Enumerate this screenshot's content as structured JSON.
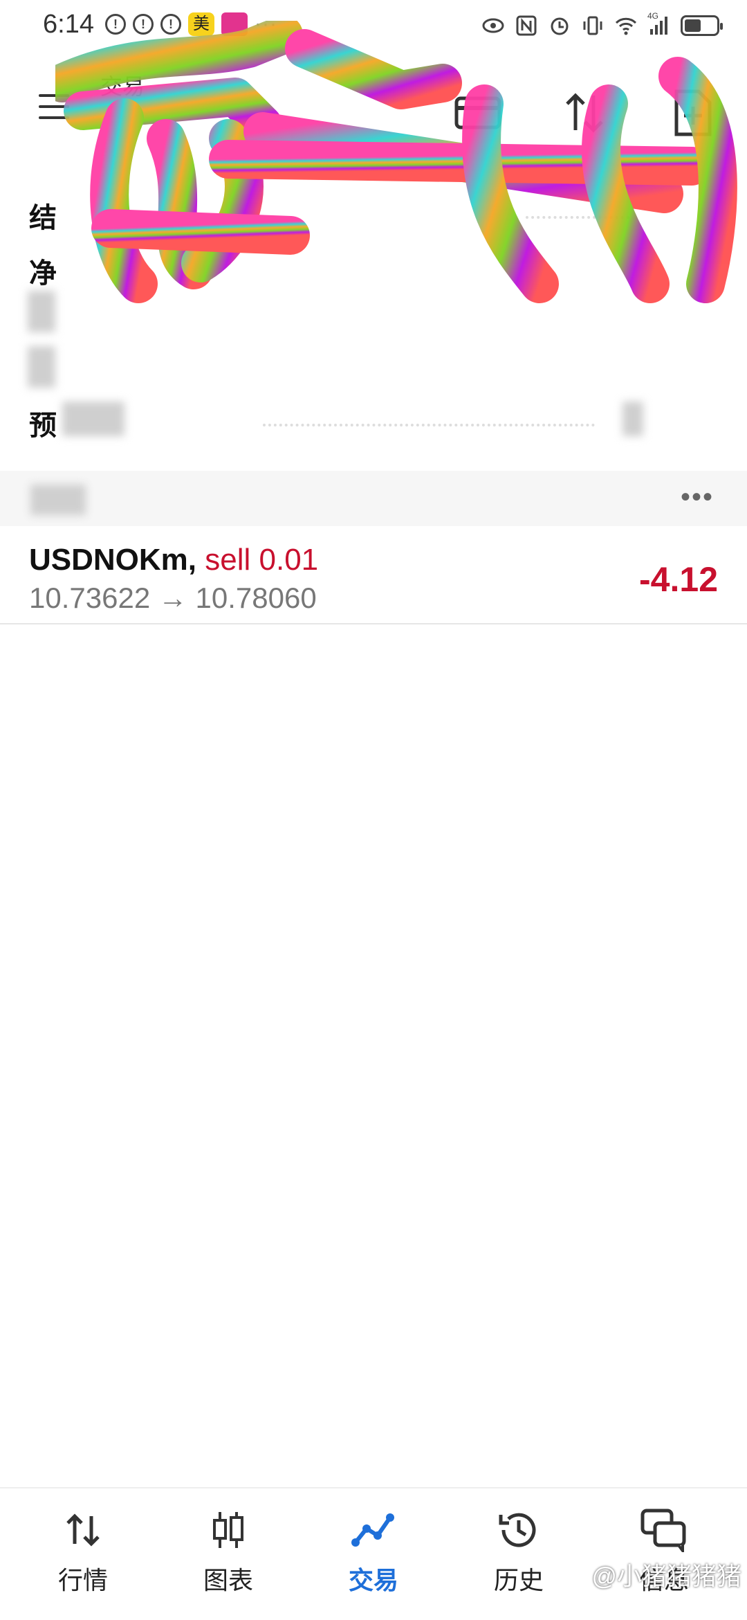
{
  "status_bar": {
    "time": "6:14",
    "badge_app": "美",
    "more": "···",
    "network": "4G"
  },
  "app_bar": {
    "title": "交易"
  },
  "summary": {
    "rows": [
      {
        "label": "结"
      },
      {
        "label": "净"
      },
      {
        "label": ""
      },
      {
        "label": ""
      },
      {
        "label": "预"
      }
    ]
  },
  "section": {
    "more": "•••"
  },
  "positions": [
    {
      "symbol": "USDNOKm,",
      "side": "sell 0.01",
      "prices": "10.73622 → 10.78060",
      "profit": "-4.12"
    }
  ],
  "bottom_nav": {
    "items": [
      {
        "label": "行情",
        "icon": "quotes-arrows-icon"
      },
      {
        "label": "图表",
        "icon": "candlestick-icon"
      },
      {
        "label": "交易",
        "icon": "trade-line-icon",
        "active": true
      },
      {
        "label": "历史",
        "icon": "history-clock-icon"
      },
      {
        "label": "信息",
        "icon": "messages-icon"
      }
    ]
  },
  "watermark": "小猪猪猪猪",
  "colors": {
    "accent": "#1e6fd9",
    "loss": "#c8102e"
  }
}
